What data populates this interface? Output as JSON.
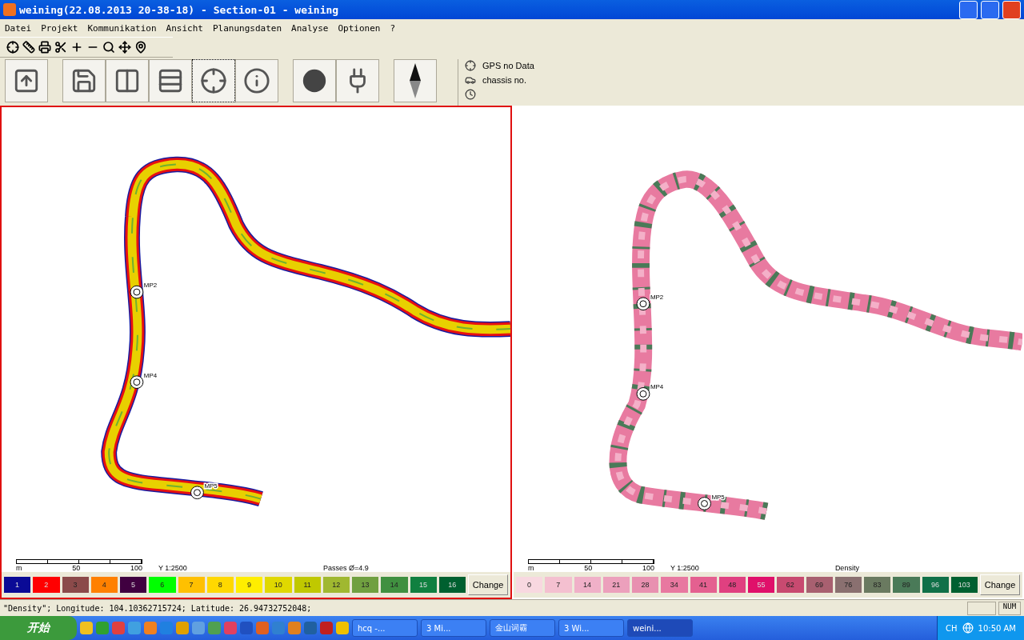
{
  "window": {
    "title": "weining(22.08.2013 20-38-18) - Section-01 - weining"
  },
  "menu": [
    "Datei",
    "Projekt",
    "Kommunikation",
    "Ansicht",
    "Planungsdaten",
    "Analyse",
    "Optionen",
    "?"
  ],
  "small_tools": [
    {
      "kind": "crosshair"
    },
    {
      "kind": "ruler"
    },
    {
      "kind": "printer"
    },
    {
      "kind": "scissors"
    },
    {
      "kind": "plus"
    },
    {
      "kind": "minus"
    },
    {
      "kind": "search"
    },
    {
      "kind": "move"
    },
    {
      "kind": "pin"
    }
  ],
  "tool_groups": [
    [
      {
        "kind": "home",
        "selected": false
      }
    ],
    [
      {
        "kind": "save",
        "selected": false
      },
      {
        "kind": "columns",
        "selected": false
      },
      {
        "kind": "rows",
        "selected": false
      },
      {
        "kind": "crosshair",
        "selected": true
      },
      {
        "kind": "info",
        "selected": false
      }
    ],
    [
      {
        "kind": "dot",
        "selected": false
      },
      {
        "kind": "plug",
        "selected": false
      }
    ],
    [
      {
        "kind": "compass",
        "selected": false
      }
    ]
  ],
  "info": [
    {
      "kind": "gps",
      "text": "GPS  no Data"
    },
    {
      "kind": "chassis",
      "text": "chassis no."
    },
    {
      "kind": "clock"
    }
  ],
  "maps": [
    {
      "kind": "passes",
      "active": true,
      "scale_ticks": [
        "m",
        "50",
        "100"
      ],
      "scale_label": "Y 1:2500",
      "legend_title": "Passes Ø=4.9",
      "change": "Change",
      "markers": [
        {
          "label": "MP2"
        },
        {
          "label": "MP4"
        },
        {
          "label": "MP5"
        }
      ],
      "legend": [
        {
          "label": "1",
          "color": "#0a0a96"
        },
        {
          "label": "2",
          "color": "#ff0000"
        },
        {
          "label": "3",
          "color": "#8b4a4a"
        },
        {
          "label": "4",
          "color": "#ff8000"
        },
        {
          "label": "5",
          "color": "#400040"
        },
        {
          "label": "6",
          "color": "#00ff00"
        },
        {
          "label": "7",
          "color": "#ffc000"
        },
        {
          "label": "8",
          "color": "#ffd800"
        },
        {
          "label": "9",
          "color": "#ffee00"
        },
        {
          "label": "10",
          "color": "#e0d800"
        },
        {
          "label": "11",
          "color": "#c0c800"
        },
        {
          "label": "12",
          "color": "#a0b830"
        },
        {
          "label": "13",
          "color": "#70a040"
        },
        {
          "label": "14",
          "color": "#409040"
        },
        {
          "label": "15",
          "color": "#108040"
        },
        {
          "label": "16",
          "color": "#006030"
        }
      ]
    },
    {
      "kind": "density",
      "active": false,
      "scale_ticks": [
        "m",
        "50",
        "100"
      ],
      "scale_label": "Y 1:2500",
      "legend_title": "Density",
      "change": "Change",
      "markers": [
        {
          "label": "MP2"
        },
        {
          "label": "MP4"
        },
        {
          "label": "MP5"
        }
      ],
      "legend": [
        {
          "label": "0",
          "color": "#f8d8e0"
        },
        {
          "label": "7",
          "color": "#f4c0d0"
        },
        {
          "label": "14",
          "color": "#f0b0c8"
        },
        {
          "label": "21",
          "color": "#eca0bc"
        },
        {
          "label": "28",
          "color": "#e890b0"
        },
        {
          "label": "34",
          "color": "#e878a0"
        },
        {
          "label": "41",
          "color": "#e46090"
        },
        {
          "label": "48",
          "color": "#e04080"
        },
        {
          "label": "55",
          "color": "#e0106a"
        },
        {
          "label": "62",
          "color": "#c84a70"
        },
        {
          "label": "69",
          "color": "#a86070"
        },
        {
          "label": "76",
          "color": "#8a7070"
        },
        {
          "label": "83",
          "color": "#6a7a60"
        },
        {
          "label": "89",
          "color": "#4a7a58"
        },
        {
          "label": "96",
          "color": "#107048"
        },
        {
          "label": "103",
          "color": "#006030"
        }
      ]
    }
  ],
  "status_bar": {
    "text": "\"Density\"; Longitude: 104.10362715724; Latitude: 26.94732752048;",
    "panes": [
      "NUM"
    ]
  },
  "taskbar": {
    "start": "开始",
    "tasks": [
      {
        "label": "hcq -...",
        "selected": false
      },
      {
        "label": "3 Mi...",
        "selected": false
      },
      {
        "label": "金山词霸",
        "selected": false
      },
      {
        "label": "3 Wi...",
        "selected": false
      },
      {
        "label": "weini...",
        "selected": true
      }
    ],
    "lang": "CH",
    "clock": "10:50 AM"
  }
}
